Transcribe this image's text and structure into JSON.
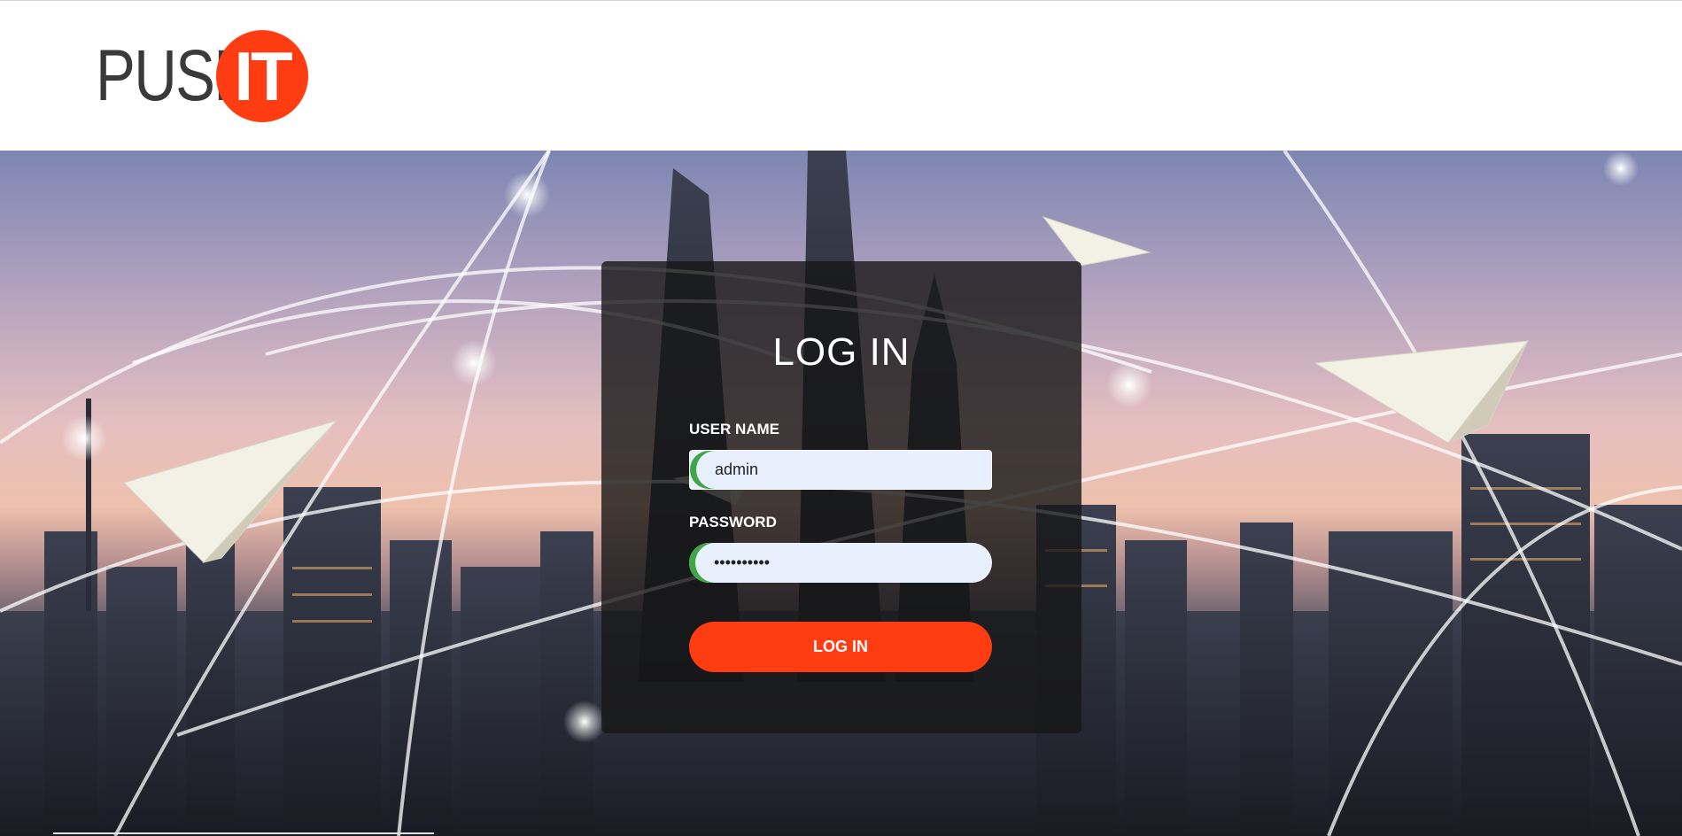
{
  "brand": {
    "wordmark": "PUSH",
    "badge": "IT",
    "accent_color": "#ff3c12"
  },
  "login": {
    "title": "LOG IN",
    "username_label": "USER NAME",
    "username_value": "admin",
    "password_label": "PASSWORD",
    "password_value": "1234567890",
    "submit_label": "LOG IN",
    "autofill_color": "#e8f0fe",
    "field_accent_color": "#3fa648"
  },
  "hero": {
    "icons": [
      "paper-plane-icon",
      "paper-plane-icon",
      "paper-plane-icon",
      "paper-plane-icon"
    ]
  }
}
